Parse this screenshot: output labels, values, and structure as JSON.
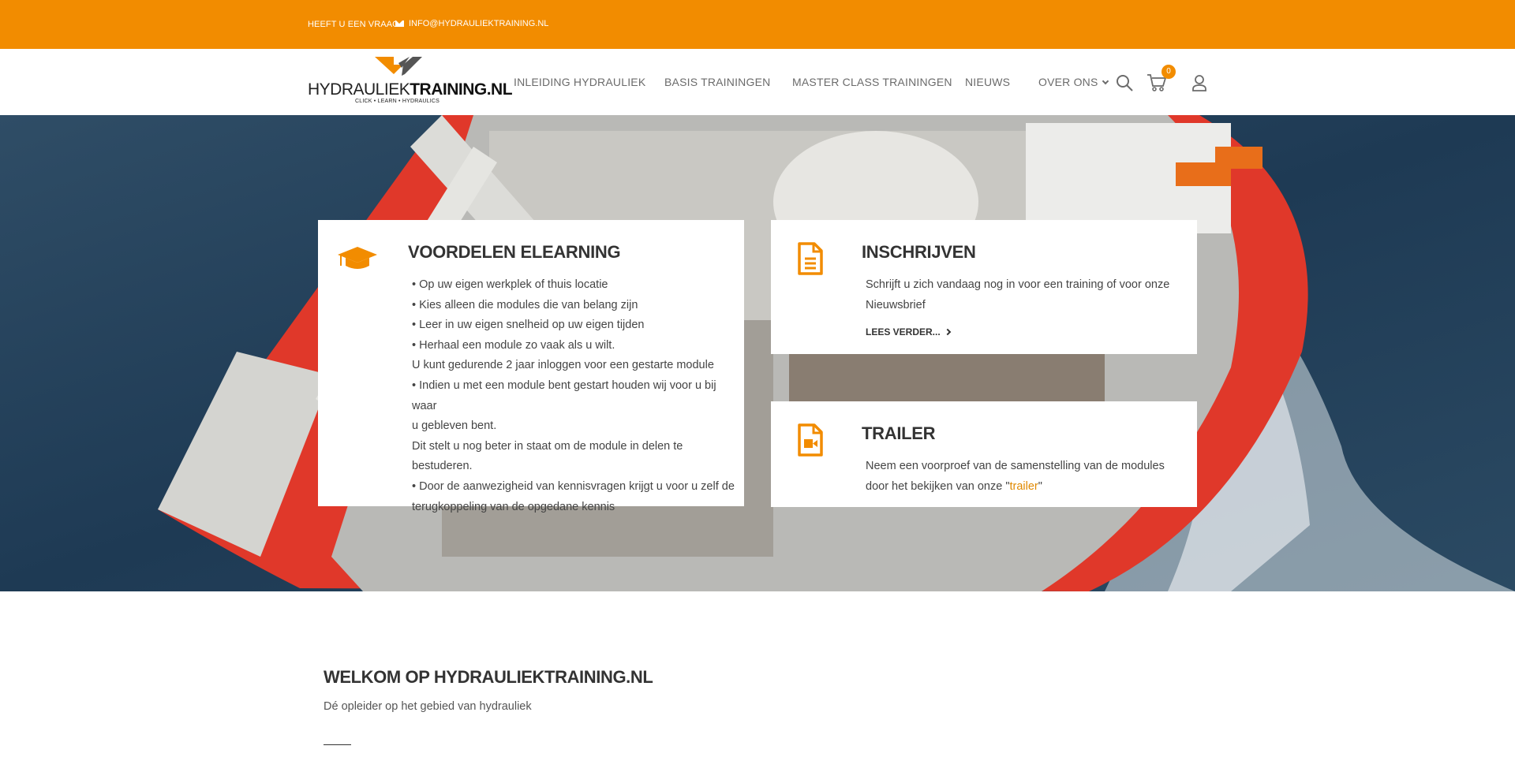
{
  "topbar": {
    "question": "HEEFT U EEN VRAAG?",
    "email": "INFO@HYDRAULIEKTRAINING.NL",
    "email_icon": "envelope-icon"
  },
  "logo": {
    "text_regular": "HYDRAULIEK",
    "text_bold": "TRAINING.NL",
    "tagline": "CLICK • LEARN • HYDRAULICS"
  },
  "nav": {
    "items": [
      "INLEIDING HYDRAULIEK",
      "BASIS TRAININGEN",
      "MASTER CLASS TRAININGEN",
      "NIEUWS",
      "OVER ONS"
    ],
    "search_icon": "search-icon",
    "cart_icon": "cart-icon",
    "cart_count": "0",
    "account_icon": "user-icon"
  },
  "cards": {
    "elearning": {
      "icon": "graduation-cap-icon",
      "title": "VOORDELEN ELEARNING",
      "lines": [
        "• Op uw eigen werkplek of thuis locatie",
        "• Kies alleen die modules die van belang zijn",
        "• Leer in uw eigen snelheid op uw eigen tijden",
        "• Herhaal een module zo vaak als u wilt.",
        "U kunt gedurende 2 jaar inloggen voor een gestarte module",
        "• Indien u met een module bent gestart houden wij voor u bij waar",
        "u gebleven bent.",
        "Dit stelt u nog beter in staat om de module in delen te bestuderen.",
        "• Door de aanwezigheid van kennisvragen krijgt u voor u zelf de",
        "terugkoppeling van de opgedane kennis"
      ]
    },
    "inschrijven": {
      "icon": "document-icon",
      "title": "INSCHRIJVEN",
      "text": "Schrijft u zich vandaag nog in voor een training of voor onze Nieuwsbrief",
      "more": "LEES VERDER..."
    },
    "trailer": {
      "icon": "video-file-icon",
      "title": "TRAILER",
      "text_before": "Neem een voorproef van de samenstelling van de modules door het bekijken van onze \"",
      "link": "trailer",
      "text_after": "\""
    }
  },
  "welcome": {
    "title": "WELKOM OP HYDRAULIEKTRAINING.NL",
    "subtitle": "Dé opleider op het gebied van hydrauliek"
  },
  "colors": {
    "accent": "#f28c00",
    "text": "#333333"
  }
}
